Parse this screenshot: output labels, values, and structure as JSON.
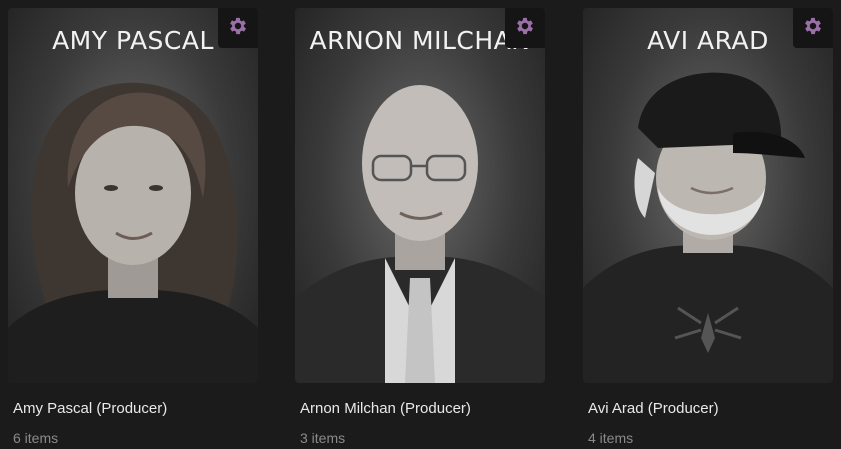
{
  "accent_color": "#9b6fa8",
  "cards": [
    {
      "poster_name": "AMY PASCAL",
      "title": "Amy Pascal (Producer)",
      "subtitle": "6 items",
      "settings_icon": "gear-icon"
    },
    {
      "poster_name": "ARNON MILCHAN",
      "title": "Arnon Milchan (Producer)",
      "subtitle": "3 items",
      "settings_icon": "gear-icon"
    },
    {
      "poster_name": "AVI ARAD",
      "title": "Avi Arad (Producer)",
      "subtitle": "4 items",
      "settings_icon": "gear-icon"
    }
  ]
}
